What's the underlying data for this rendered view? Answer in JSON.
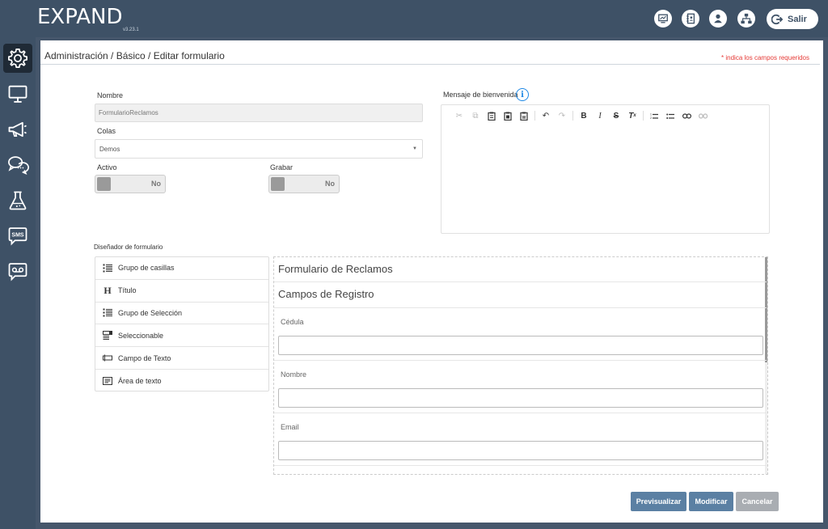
{
  "app": {
    "logo_text": "EXPAND",
    "version": "v3.23.1"
  },
  "topbar": {
    "icons": [
      "monitor-chart-icon",
      "contact-book-icon",
      "user-icon",
      "org-chart-icon"
    ],
    "logout_label": "Salir"
  },
  "sidebar": {
    "items": [
      {
        "name": "settings",
        "icon": "gear-icon",
        "active": true
      },
      {
        "name": "monitor",
        "icon": "monitor-icon",
        "active": false
      },
      {
        "name": "campaigns",
        "icon": "megaphone-icon",
        "active": false
      },
      {
        "name": "chat",
        "icon": "chat-bubbles-icon",
        "active": false
      },
      {
        "name": "lab",
        "icon": "flask-icon",
        "active": false
      },
      {
        "name": "sms",
        "icon": "sms-icon",
        "active": false,
        "text": "SMS"
      },
      {
        "name": "voicemail",
        "icon": "voicemail-icon",
        "active": false
      }
    ]
  },
  "header": {
    "breadcrumb": "Administración / Básico / Editar formulario",
    "required_note": "* indica los campos requeridos"
  },
  "form": {
    "name_label": "Nombre",
    "name_value": "FormularioReclamos",
    "queue_label": "Colas",
    "queue_value": "Demos",
    "active_label": "Activo",
    "active_value": "No",
    "record_label": "Grabar",
    "record_value": "No",
    "welcome_label": "Mensaje de bienvenida",
    "info_glyph": "i"
  },
  "designer": {
    "label": "Diseñador de formulario",
    "palette": [
      {
        "label": "Grupo de casillas",
        "icon": "checklist-icon"
      },
      {
        "label": "Título",
        "icon": "heading-icon"
      },
      {
        "label": "Grupo de Selección",
        "icon": "radio-list-icon"
      },
      {
        "label": "Seleccionable",
        "icon": "select-icon"
      },
      {
        "label": "Campo de Texto",
        "icon": "text-field-icon"
      },
      {
        "label": "Área de texto",
        "icon": "textarea-icon"
      }
    ],
    "form_title": "Formulario de Reclamos",
    "section_title": "Campos de Registro",
    "fields": [
      {
        "label": "Cédula",
        "value": ""
      },
      {
        "label": "Nombre",
        "value": ""
      },
      {
        "label": "Email",
        "value": ""
      }
    ]
  },
  "buttons": {
    "preview": "Previsualizar",
    "modify": "Modificar",
    "cancel": "Cancelar"
  },
  "colors": {
    "topbar": "#3e5166",
    "primary_button": "#5b80a3",
    "cancel_button": "#a9adb2",
    "required": "#e53935",
    "info": "#1e88e5"
  }
}
